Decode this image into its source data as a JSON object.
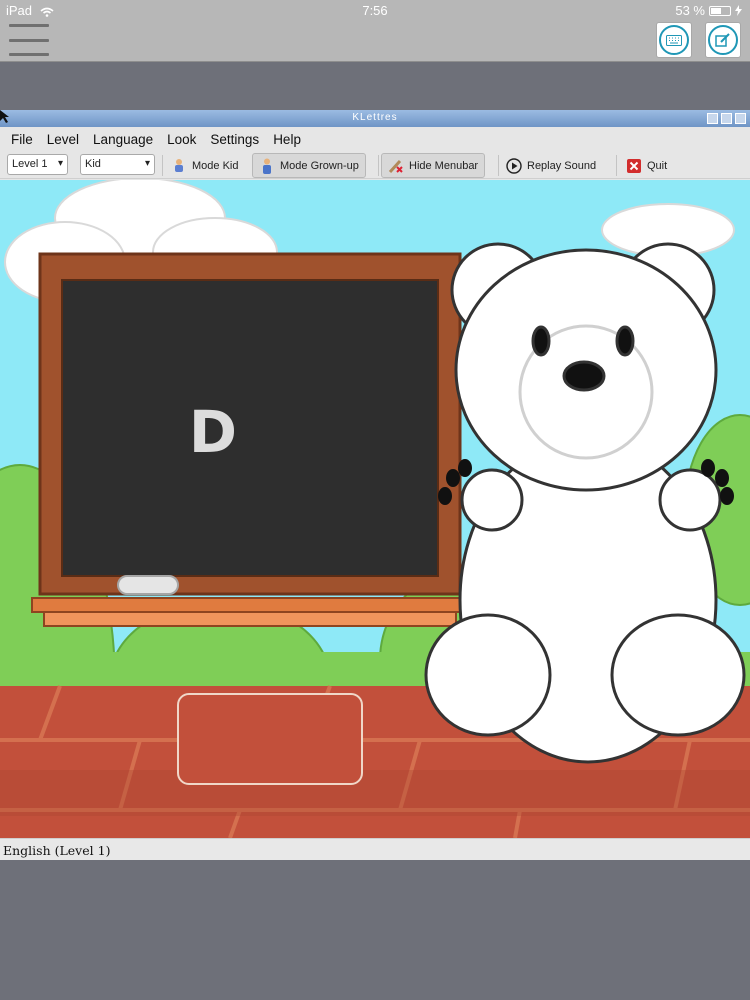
{
  "ios": {
    "carrier": "iPad",
    "time": "7:56",
    "battery": "53 %",
    "battery_level": 0.53,
    "icons": [
      "wifi-icon",
      "menu-icon",
      "keyboard-icon",
      "edit-icon",
      "battery-icon",
      "charging-icon"
    ]
  },
  "window": {
    "title": "KLettres"
  },
  "menu": {
    "file": "File",
    "level": "Level",
    "language": "Language",
    "look": "Look",
    "settings": "Settings",
    "help": "Help"
  },
  "toolbar": {
    "level_value": "Level 1",
    "look_value": "Kid",
    "mode_kid": "Mode Kid",
    "mode_grownup": "Mode Grown-up",
    "hide_menubar": "Hide Menubar",
    "replay_sound": "Replay Sound",
    "quit": "Quit"
  },
  "board": {
    "letter": "D"
  },
  "statusbar": {
    "text": "English  (Level 1)"
  },
  "colors": {
    "sky": "#8ee9f7",
    "blackboard": "#2e2e2e",
    "frame": "#a0522d",
    "bricks": "#c2503b",
    "hills": "#7fce57",
    "titlebar": "#7fa3d2"
  }
}
